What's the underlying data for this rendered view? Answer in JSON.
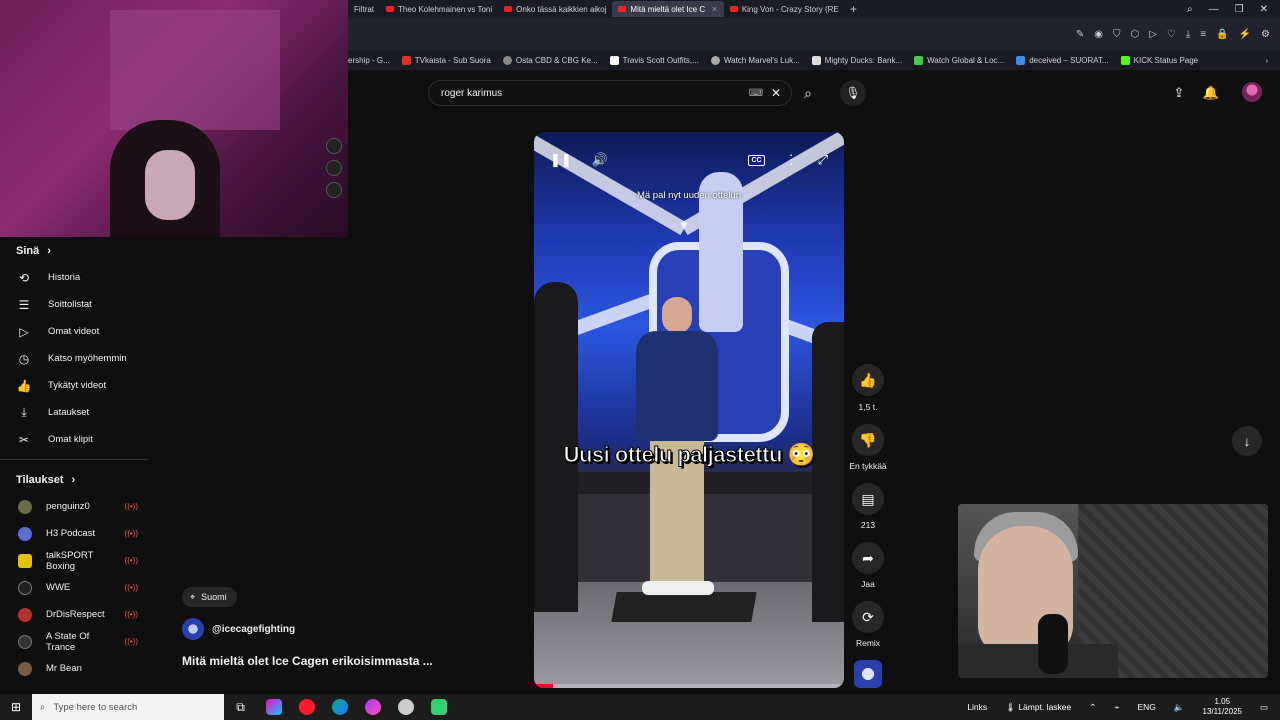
{
  "browser": {
    "tabs": [
      {
        "label": "Filtrat"
      },
      {
        "label": "Theo Kolehmainen vs Toni"
      },
      {
        "label": "Onko tässä kaikkien aikoj"
      },
      {
        "label": "Mitä mieltä olet Ice C",
        "active": true
      },
      {
        "label": "King Von - Crazy Story (RE"
      }
    ],
    "bookmarks": [
      {
        "label": "ership - G...",
        "color": "#555"
      },
      {
        "label": "TVkaista - Sub Suora",
        "color": "#d32"
      },
      {
        "label": "Osta CBD & CBG Ke...",
        "color": "#888"
      },
      {
        "label": "Travis Scott Outfits,...",
        "color": "#fff"
      },
      {
        "label": "Watch Marvel's Luk...",
        "color": "#aaa"
      },
      {
        "label": "Mighty Ducks: Bank...",
        "color": "#ddd"
      },
      {
        "label": "Watch Global & Loc...",
        "color": "#4c4"
      },
      {
        "label": "deceived – SUORAT...",
        "color": "#3a8ee6"
      },
      {
        "label": "KICK Status Page",
        "color": "#53fc18"
      }
    ]
  },
  "search": {
    "value": "roger karimus"
  },
  "sidebar": {
    "you_title": "Sinä",
    "items": [
      {
        "label": "Historia",
        "icon": "history-icon",
        "glyph": "⟲"
      },
      {
        "label": "Soittolistat",
        "icon": "playlist-icon",
        "glyph": "☰"
      },
      {
        "label": "Omat videot",
        "icon": "my-videos-icon",
        "glyph": "▷"
      },
      {
        "label": "Katso myöhemmin",
        "icon": "watch-later-icon",
        "glyph": "◷"
      },
      {
        "label": "Tykätyt videot",
        "icon": "liked-icon",
        "glyph": "👍"
      },
      {
        "label": "Lataukset",
        "icon": "download-icon",
        "glyph": "⤓"
      },
      {
        "label": "Omat klipit",
        "icon": "scissors-icon",
        "glyph": "✂"
      }
    ],
    "subs_title": "Tilaukset",
    "subscriptions": [
      {
        "label": "penguinz0",
        "color": "#6b6b48"
      },
      {
        "label": "H3 Podcast",
        "color": "#5a6fd6"
      },
      {
        "label": "talkSPORT Boxing",
        "color": "#e8c30b"
      },
      {
        "label": "WWE",
        "color": "#222"
      },
      {
        "label": "DrDisRespect",
        "color": "#b3322c"
      },
      {
        "label": "A State Of Trance",
        "color": "#333"
      },
      {
        "label": "Mr Bean",
        "color": "#7a5a40"
      }
    ],
    "live_glyph": "((•))"
  },
  "video": {
    "subtitle": "Mä pal nyt uuden ottelun",
    "caption": "Uusi ottelu paljastettu 😳",
    "progress": 0.06,
    "location": "Suomi",
    "channel": "@icecagefighting",
    "title": "Mitä mieltä olet Ice Cagen erikoisimmasta ..."
  },
  "actions": {
    "likes": "1,5 t.",
    "dislike": "En tykkää",
    "comments": "213",
    "share": "Jaa",
    "remix": "Remix"
  },
  "taskbar": {
    "search_placeholder": "Type here to search",
    "links": "Links",
    "weather": "Lämpt. laskee",
    "lang": "ENG",
    "time": "1.05",
    "date": "13/11/2025"
  }
}
